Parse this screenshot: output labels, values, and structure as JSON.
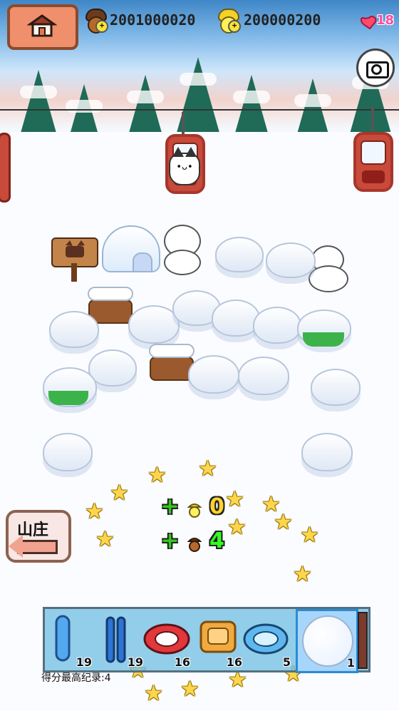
{
  "top_bar": {
    "acorn_brown_value": "2001000020",
    "acorn_gold_value": "200000200",
    "heart_count": "18"
  },
  "left_nav": {
    "lodge_label": "山庄"
  },
  "reward": {
    "gold_amount": "0",
    "brown_amount": "4"
  },
  "tray": {
    "items": [
      {
        "name": "sled-blue",
        "count": "19"
      },
      {
        "name": "skis-blue",
        "count": "19"
      },
      {
        "name": "snow-ring-red",
        "count": "16"
      },
      {
        "name": "snow-bed-orange",
        "count": "16"
      },
      {
        "name": "snow-ring-blue",
        "count": "5"
      },
      {
        "name": "snowball",
        "count": "1"
      }
    ]
  },
  "score": {
    "text": "得分最高纪录:4"
  }
}
